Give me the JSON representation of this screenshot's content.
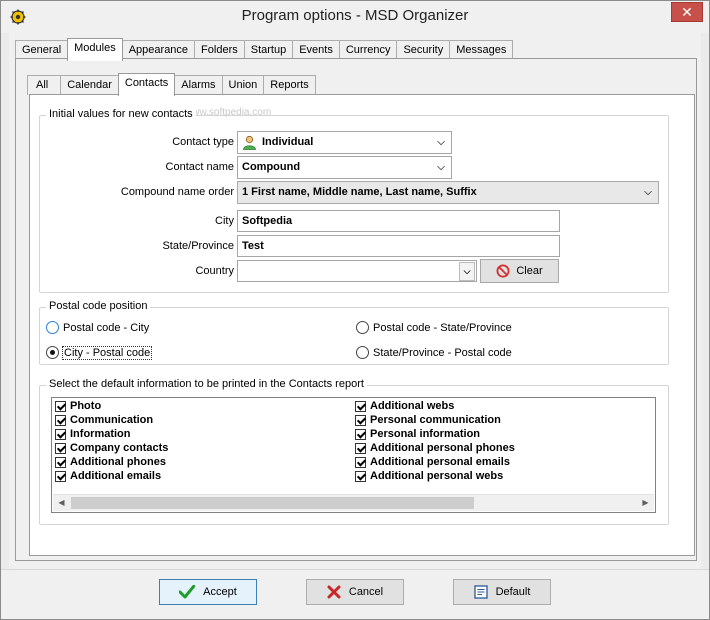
{
  "window": {
    "title": "Program options - MSD Organizer",
    "close_glyph": "✕"
  },
  "main_tabs": [
    "General",
    "Modules",
    "Appearance",
    "Folders",
    "Startup",
    "Events",
    "Currency",
    "Security",
    "Messages"
  ],
  "active_main_tab": "Modules",
  "sub_tabs": [
    "All",
    "Calendar",
    "Contacts",
    "Alarms",
    "Union",
    "Reports"
  ],
  "active_sub_tab": "Contacts",
  "watermark": "www.softpedia.com",
  "initial_values": {
    "legend": "Initial values for new contacts",
    "contact_type_label": "Contact type",
    "contact_type_value": "Individual",
    "contact_name_label": "Contact name",
    "contact_name_value": "Compound",
    "compound_order_label": "Compound name order",
    "compound_order_value": "1 First name, Middle name, Last name, Suffix",
    "city_label": "City",
    "city_value": "Softpedia",
    "state_label": "State/Province",
    "state_value": "Test",
    "country_label": "Country",
    "country_value": "",
    "clear_label": "Clear"
  },
  "postal": {
    "legend": "Postal code position",
    "options": [
      "Postal code - City",
      "Postal code - State/Province",
      "City - Postal code",
      "State/Province - Postal code"
    ],
    "selected": "City - Postal code"
  },
  "report": {
    "legend": "Select the default information to be printed in the Contacts report",
    "left_items": [
      "Photo",
      "Communication",
      "Information",
      "Company contacts",
      "Additional phones",
      "Additional emails"
    ],
    "right_items": [
      "Additional webs",
      "Personal communication",
      "Personal information",
      "Additional personal phones",
      "Additional personal emails",
      "Additional personal webs"
    ]
  },
  "footer": {
    "accept_label": "Accept",
    "cancel_label": "Cancel",
    "default_label": "Default"
  },
  "colors": {
    "accent": "#3c7fb1",
    "accept_icon": "#1f9d2b",
    "cancel_icon": "#c62828",
    "clear_icon": "#d32f2f"
  }
}
